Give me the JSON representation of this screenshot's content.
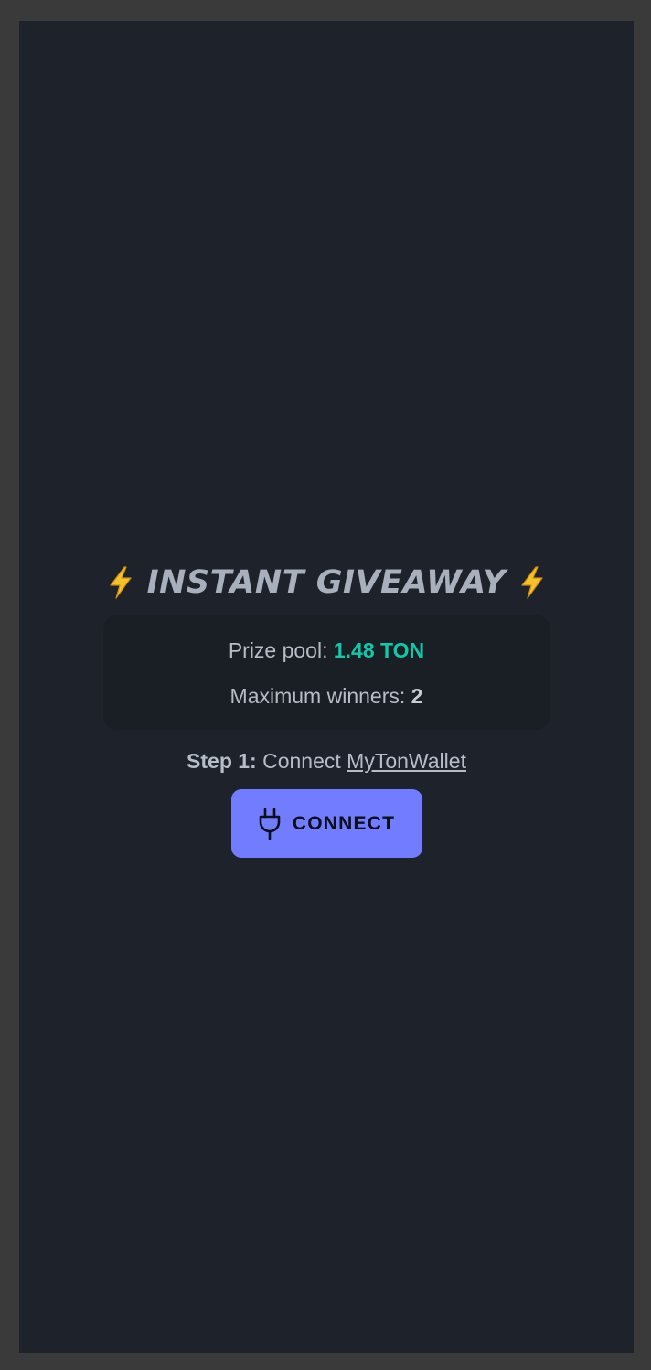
{
  "header": {
    "title": "INSTANT GIVEAWAY",
    "left_icon": "lightning-bolt-icon",
    "right_icon": "lightning-bolt-icon"
  },
  "info": {
    "prize_label": "Prize pool:",
    "prize_value": "1.48 TON",
    "winners_label": "Maximum winners:",
    "winners_value": "2"
  },
  "step": {
    "label": "Step 1:",
    "text": "Connect",
    "link_text": "MyTonWallet"
  },
  "connect_button": {
    "label": "CONNECT",
    "icon": "plug-icon"
  },
  "colors": {
    "background": "#1e232b",
    "accent": "#12c8a8",
    "button": "#727cff"
  }
}
